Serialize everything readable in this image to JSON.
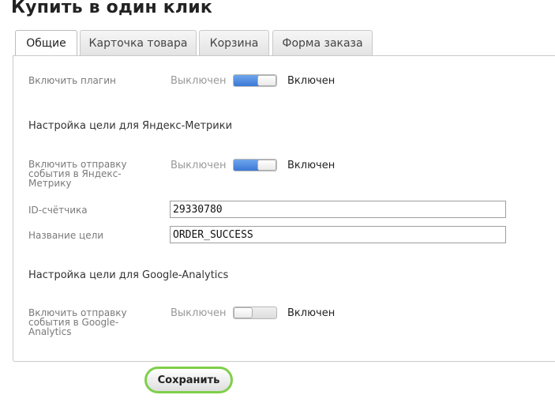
{
  "page": {
    "title": "Купить в один клик"
  },
  "tabs": [
    {
      "label": "Общие",
      "active": true
    },
    {
      "label": "Карточка товара",
      "active": false
    },
    {
      "label": "Корзина",
      "active": false
    },
    {
      "label": "Форма заказа",
      "active": false
    }
  ],
  "general": {
    "enable_plugin": {
      "label": "Включить плагин",
      "off_label": "Выключен",
      "on_label": "Включен",
      "enabled": true
    }
  },
  "yandex": {
    "section_title": "Настройка цели для Яндекс-Метрики",
    "enable_event": {
      "label": "Включить отправку события в Яндекс-Метрику",
      "off_label": "Выключен",
      "on_label": "Включен",
      "enabled": true
    },
    "counter_id": {
      "label": "ID-счётчика",
      "value": "29330780"
    },
    "goal_name": {
      "label": "Название цели",
      "value": "ORDER_SUCCESS"
    }
  },
  "google": {
    "section_title": "Настройка цели для Google-Analytics",
    "enable_event": {
      "label": "Включить отправку события в Google-Analytics",
      "off_label": "Выключен",
      "on_label": "Включен",
      "enabled": false
    }
  },
  "actions": {
    "save_label": "Сохранить"
  },
  "colors": {
    "toggle_on": "#3b78d6",
    "save_border": "#7fcf4a"
  }
}
